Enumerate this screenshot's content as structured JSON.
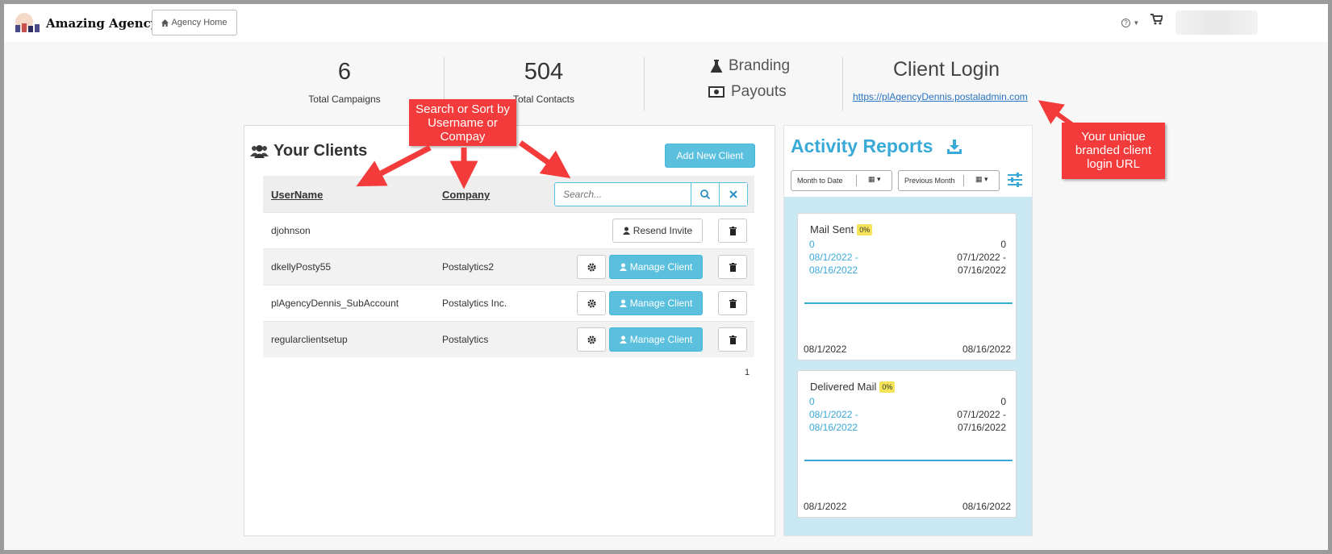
{
  "header": {
    "brand_name": "Amazing Agency",
    "home_button_label": "Agency Home",
    "help_label": "?"
  },
  "stats": {
    "campaigns": {
      "value": "6",
      "label": "Total Campaigns"
    },
    "contacts": {
      "value": "504",
      "label": "Total Contacts"
    },
    "links": {
      "branding": "Branding",
      "payouts": "Payouts"
    },
    "client_login": {
      "title": "Client Login",
      "url": "https://plAgencyDennis.postaladmin.com"
    }
  },
  "clients": {
    "title": "Your Clients",
    "add_button_label": "Add New Client",
    "columns": {
      "username": "UserName",
      "company": "Company"
    },
    "search_placeholder": "Search...",
    "resend_label": "Resend Invite",
    "manage_label": "Manage Client",
    "rows": [
      {
        "username": "djohnson",
        "company": "",
        "status": "invite"
      },
      {
        "username": "dkellyPosty55",
        "company": "Postalytics2",
        "status": "active"
      },
      {
        "username": "plAgencyDennis_SubAccount",
        "company": "Postalytics Inc.",
        "status": "active"
      },
      {
        "username": "regularclientsetup",
        "company": "Postalytics",
        "status": "active"
      }
    ],
    "page_number": "1"
  },
  "activity": {
    "title": "Activity Reports",
    "range_1": "Month to Date",
    "range_2": "Previous Month",
    "cards": [
      {
        "title": "Mail Sent",
        "badge": "0%",
        "current_value": "0",
        "current_range_line1": "08/1/2022 -",
        "current_range_line2": "08/16/2022",
        "previous_value": "0",
        "previous_range_line1": "07/1/2022 -",
        "previous_range_line2": "07/16/2022",
        "axis_start": "08/1/2022",
        "axis_end": "08/16/2022"
      },
      {
        "title": "Delivered Mail",
        "badge": "0%",
        "current_value": "0",
        "current_range_line1": "08/1/2022 -",
        "current_range_line2": "08/16/2022",
        "previous_value": "0",
        "previous_range_line1": "07/1/2022 -",
        "previous_range_line2": "07/16/2022",
        "axis_start": "08/1/2022",
        "axis_end": "08/16/2022"
      }
    ]
  },
  "annotations": {
    "search_callout": "Search or Sort by Username or Compay",
    "url_callout": "Your unique branded client login URL"
  },
  "colors": {
    "accent": "#5bc0de",
    "callout": "#f43b3b",
    "badge": "#f5e45a",
    "title_blue": "#39a9d8"
  }
}
